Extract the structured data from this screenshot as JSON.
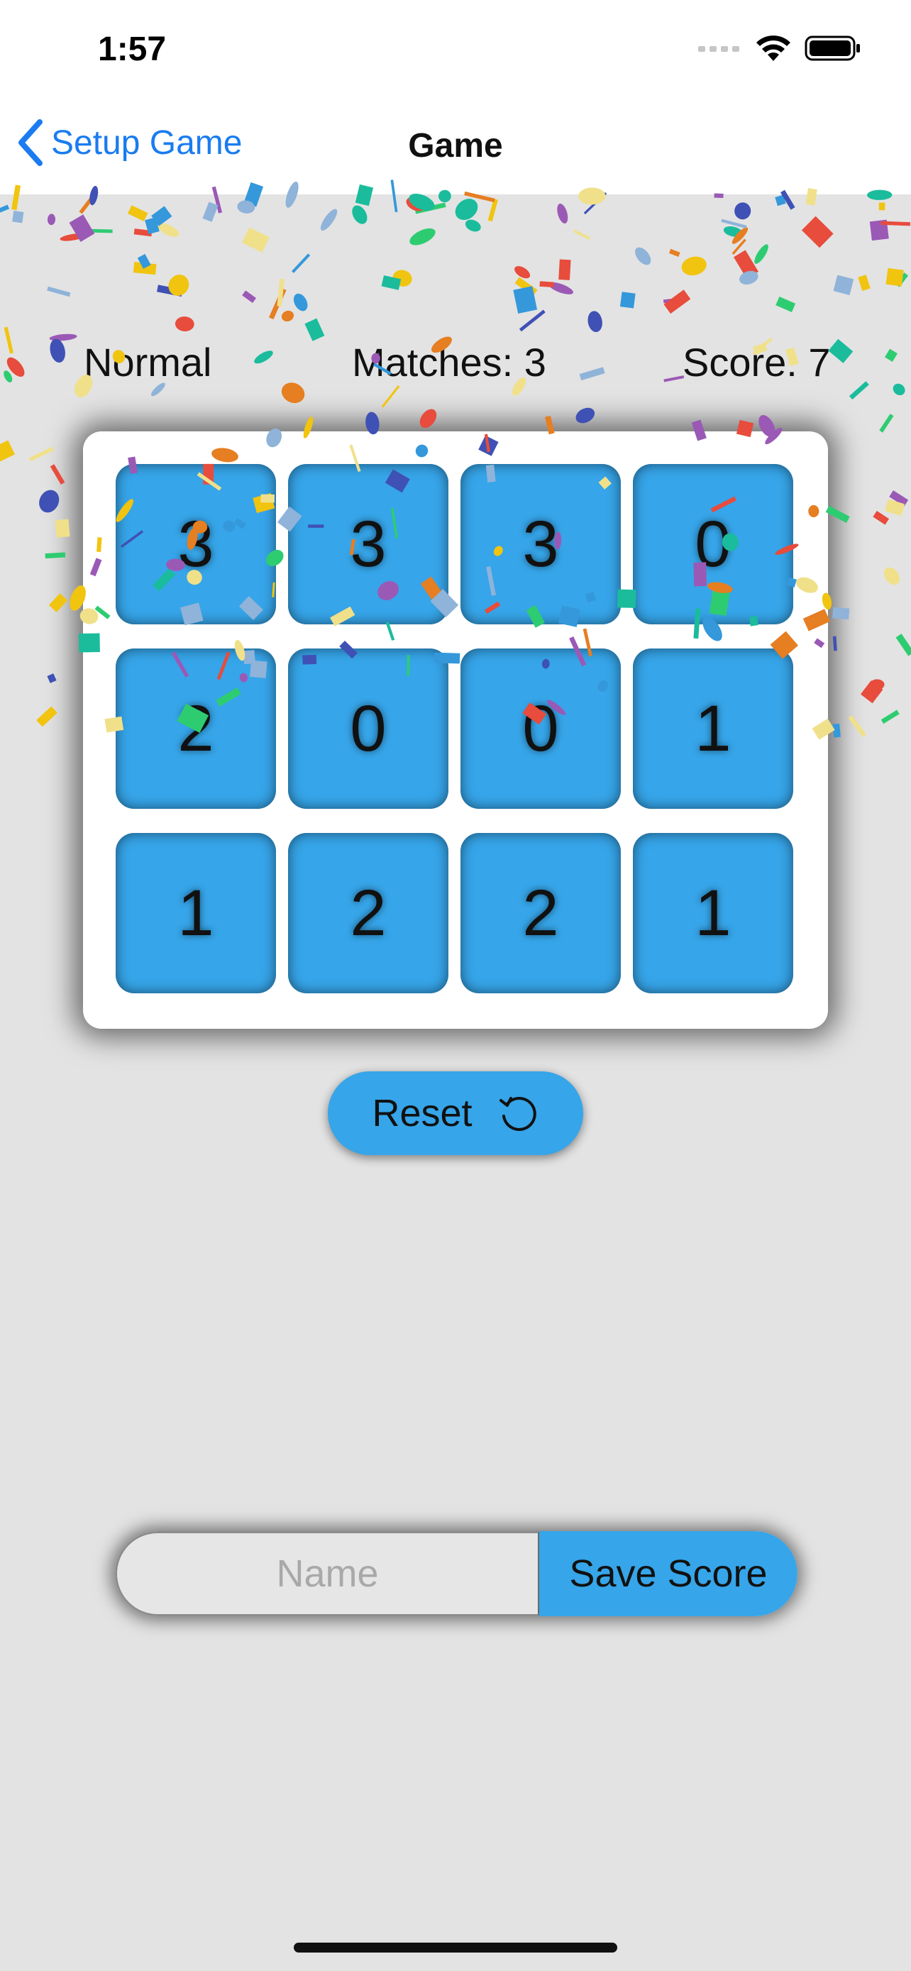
{
  "status_bar": {
    "time": "1:57"
  },
  "nav": {
    "back_label": "Setup Game",
    "title": "Game"
  },
  "stats": {
    "mode": "Normal",
    "matches": "Matches: 3",
    "score": "Score: 7"
  },
  "board": {
    "rows": [
      [
        "3",
        "3",
        "3",
        "0"
      ],
      [
        "2",
        "0",
        "0",
        "1"
      ],
      [
        "1",
        "2",
        "2",
        "1"
      ]
    ]
  },
  "reset": {
    "label": "Reset",
    "icon": "reset-icon"
  },
  "save": {
    "name_placeholder": "Name",
    "name_value": "",
    "button_label": "Save Score"
  },
  "colors": {
    "tile": "#36a5e9",
    "accent_link": "#1a7cf0",
    "background": "#e3e3e3"
  }
}
